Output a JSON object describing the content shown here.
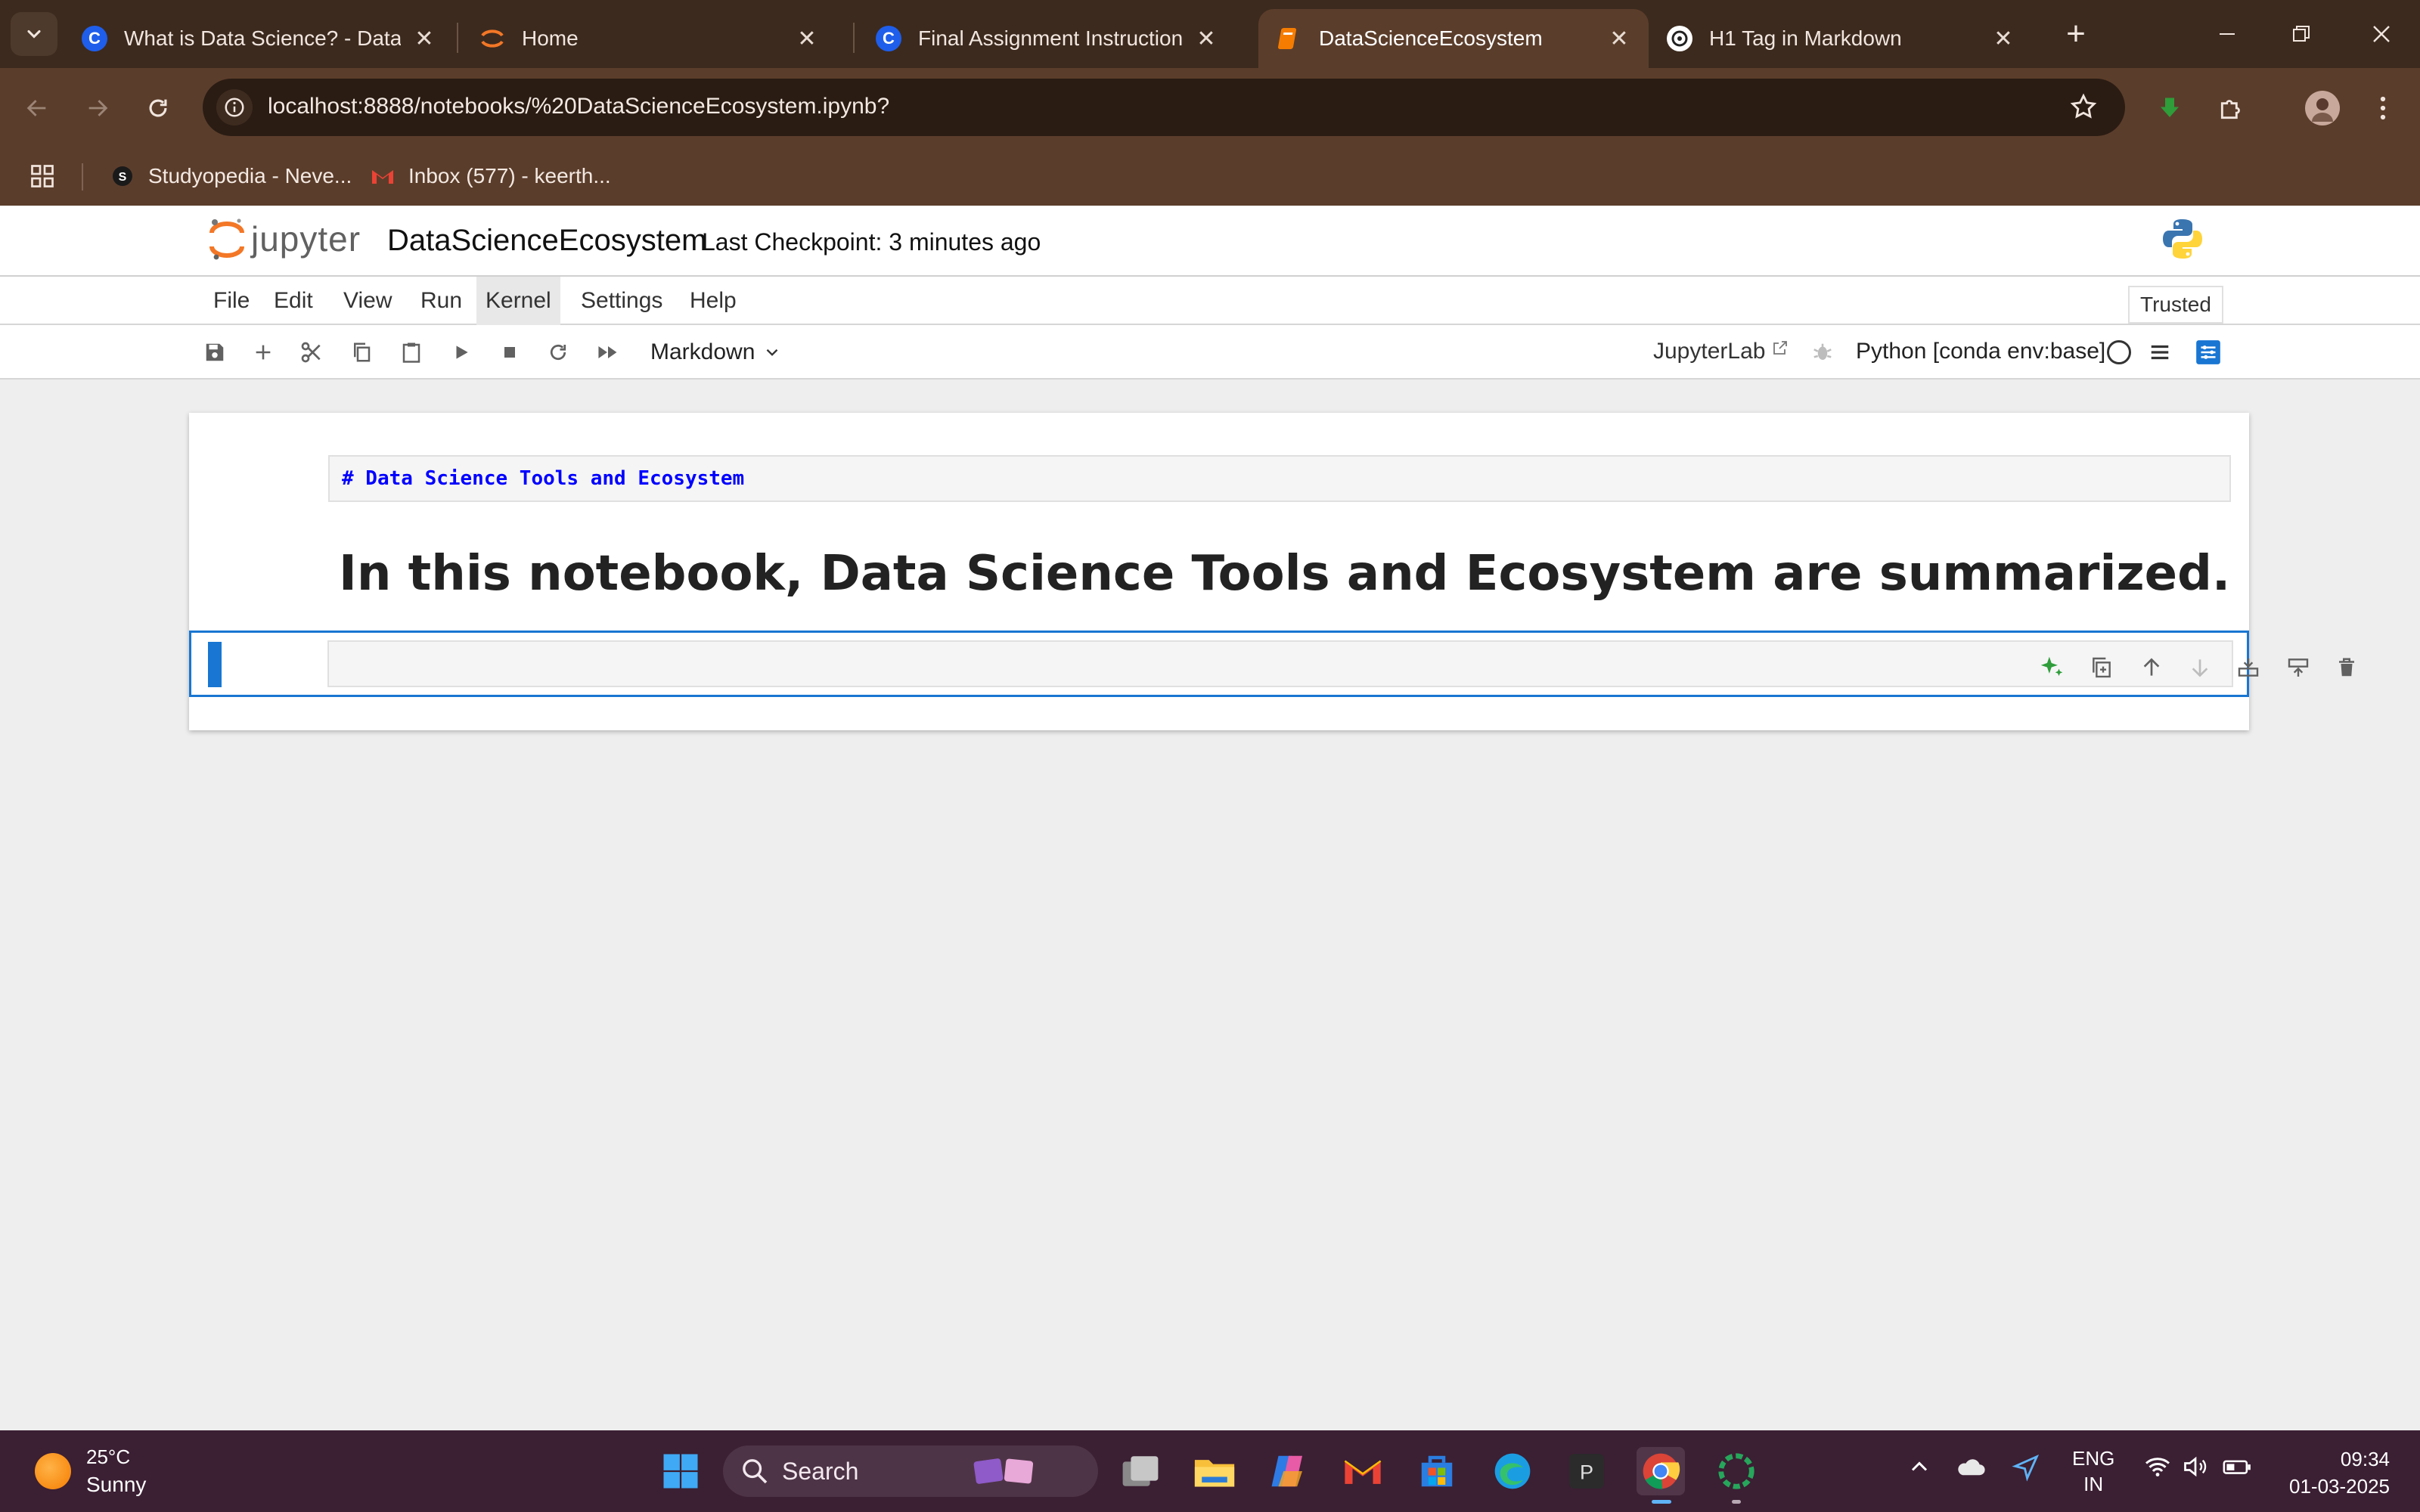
{
  "browser": {
    "tabs": [
      {
        "title": "What is Data Science? - Data Ll",
        "favicon": "coursera-icon",
        "active": false
      },
      {
        "title": "Home",
        "favicon": "jupyter-icon",
        "active": false
      },
      {
        "title": "Final Assignment Instructions: I",
        "favicon": "coursera-icon",
        "active": false
      },
      {
        "title": "DataScienceEcosystem",
        "favicon": "notebook-icon",
        "active": true
      },
      {
        "title": "H1 Tag in Markdown",
        "favicon": "openai-icon",
        "active": false
      }
    ],
    "close_glyph": "✕",
    "new_tab_glyph": "+",
    "url": "localhost:8888/notebooks/%20DataScienceEcosystem.ipynb?",
    "bookmarks": [
      {
        "label": "Studyopedia - Neve...",
        "icon": "studyopedia-icon"
      },
      {
        "label": "Inbox (577) - keerth...",
        "icon": "gmail-icon"
      }
    ]
  },
  "jupyter": {
    "logo_text": "jupyter",
    "notebook_name": "DataScienceEcosystem",
    "checkpoint": "Last Checkpoint: 3 minutes ago",
    "menus": [
      "File",
      "Edit",
      "View",
      "Run",
      "Kernel",
      "Settings",
      "Help"
    ],
    "hovered_menu": "Kernel",
    "trusted_label": "Trusted",
    "cell_type": "Markdown",
    "jupyterlab_label": "JupyterLab",
    "kernel_label": "Python [conda env:base]",
    "cells": [
      {
        "type": "markdown",
        "source": "# Data Science Tools and Ecosystem",
        "rendered": "In this notebook, Data Science Tools and Ecosystem are summarized."
      },
      {
        "type": "markdown",
        "source": "",
        "active": true
      }
    ]
  },
  "taskbar": {
    "weather_temp": "25°C",
    "weather_desc": "Sunny",
    "search_label": "Search",
    "lang_line1": "ENG",
    "lang_line2": "IN",
    "time": "09:34",
    "date": "01-03-2025"
  },
  "colors": {
    "browser_frame": "#3c2a1e",
    "browser_toolbar": "#5b3d2b",
    "jupyter_accent": "#f37726",
    "active_cell_border": "#1976d2",
    "markdown_source": "#0000ff",
    "taskbar": "#3b1f33"
  }
}
